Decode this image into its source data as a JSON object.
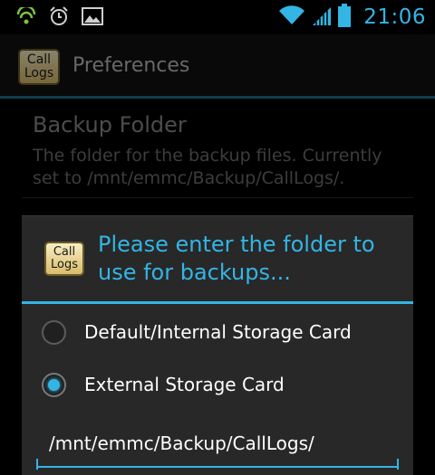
{
  "status_bar": {
    "time": "21:06",
    "icons": [
      "android-debug-icon",
      "alarm-clock-icon",
      "image-gallery-icon",
      "wifi-icon",
      "cell-signal-icon",
      "battery-icon"
    ]
  },
  "action_bar": {
    "app_icon_line1": "Call",
    "app_icon_line2": "Logs",
    "title": "Preferences"
  },
  "preferences": {
    "backup_folder_title": "Backup Folder",
    "backup_folder_summary": "The folder for the backup files. Currently set to /mnt/emmc/Backup/CallLogs/."
  },
  "dialog": {
    "icon_line1": "Call",
    "icon_line2": "Logs",
    "title": "Please enter the folder to use for backups...",
    "options": [
      {
        "label": "Default/Internal Storage Card",
        "selected": false
      },
      {
        "label": "External Storage Card",
        "selected": true
      }
    ],
    "folder_value": "/mnt/emmc/Backup/CallLogs/"
  },
  "colors": {
    "accent": "#33b5e5",
    "background": "#000000",
    "dialog_background": "#282828"
  }
}
